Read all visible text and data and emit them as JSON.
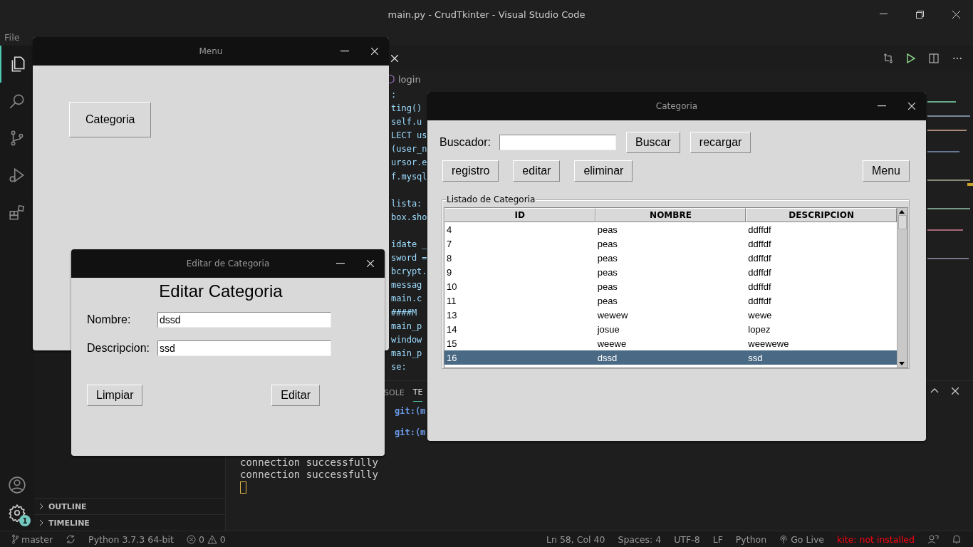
{
  "window": {
    "title": "main.py - CrudTkinter - Visual Studio Code"
  },
  "menu_bar": [
    "File"
  ],
  "activity_bar": [
    {
      "kind": "explorer",
      "selected": true
    },
    {
      "kind": "search",
      "selected": false
    },
    {
      "kind": "source-control",
      "selected": false
    },
    {
      "kind": "run",
      "selected": false
    },
    {
      "kind": "extensions",
      "selected": false
    }
  ],
  "settings_badge": "1",
  "sidebar": {
    "sections": [
      "OUTLINE",
      "TIMELINE"
    ]
  },
  "editor": {
    "breadcrumb": "login",
    "code_blocks": [
      [
        ":",
        "ting()",
        "self.u",
        "LECT us",
        "(user_n",
        "ursor.e",
        "f.mysql"
      ],
      [
        "lista:",
        "box.sho"
      ],
      [
        "idate _",
        "sword =",
        "bcrypt.",
        "messag",
        "main.c",
        "####M",
        "main_p",
        "window",
        "main_p",
        "se:"
      ]
    ]
  },
  "panel": {
    "tabs": [
      {
        "label": "SOLE",
        "selected": false
      },
      {
        "label": "TE",
        "selected": true
      }
    ],
    "terminal_lines": [
      {
        "kind": "git",
        "text": "git:(m"
      },
      {
        "kind": "git",
        "text": "git:(m"
      },
      {
        "kind": "output",
        "text": "connection successfully"
      },
      {
        "kind": "output",
        "text": "connection successfully"
      }
    ]
  },
  "status_bar": {
    "branch": "master",
    "interpreter": "Python 3.7.3 64-bit",
    "errors": "0",
    "warnings": "0",
    "position": "Ln 58, Col 40",
    "indent": "Spaces: 4",
    "encoding": "UTF-8",
    "eol": "LF",
    "language": "Python",
    "live": "Go Live",
    "kite": "kite: not installed"
  },
  "menu_window": {
    "title": "Menu",
    "buttons": [
      "Categoria"
    ]
  },
  "edit_window": {
    "title": "Editar de Categoria",
    "heading": "Editar Categoria",
    "fields": [
      {
        "label": "Nombre:",
        "value": "dssd"
      },
      {
        "label": "Descripcion:",
        "value": "ssd"
      }
    ],
    "buttons": [
      "Limpiar",
      "Editar"
    ]
  },
  "category_window": {
    "title": "Categoria",
    "search_label": "Buscador:",
    "search_buttons": [
      "Buscar",
      "recargar"
    ],
    "actions": [
      "registro",
      "editar",
      "eliminar"
    ],
    "menu_button": "Menu",
    "list": {
      "title": "Listado de Categoria",
      "columns": [
        "ID",
        "NOMBRE",
        "DESCRIPCION"
      ],
      "rows": [
        {
          "cells": [
            "4",
            "peas",
            "ddffdf"
          ],
          "selected": false
        },
        {
          "cells": [
            "7",
            "peas",
            "ddffdf"
          ],
          "selected": false
        },
        {
          "cells": [
            "8",
            "peas",
            "ddffdf"
          ],
          "selected": false
        },
        {
          "cells": [
            "9",
            "peas",
            "ddffdf"
          ],
          "selected": false
        },
        {
          "cells": [
            "10",
            "peas",
            "ddffdf"
          ],
          "selected": false
        },
        {
          "cells": [
            "11",
            "peas",
            "ddffdf"
          ],
          "selected": false
        },
        {
          "cells": [
            "13",
            "wewew",
            "wewe"
          ],
          "selected": false
        },
        {
          "cells": [
            "14",
            "josue",
            "lopez"
          ],
          "selected": false
        },
        {
          "cells": [
            "15",
            "weewe",
            "weewewe"
          ],
          "selected": false
        },
        {
          "cells": [
            "16",
            "dssd",
            "ssd"
          ],
          "selected": true
        }
      ]
    }
  }
}
